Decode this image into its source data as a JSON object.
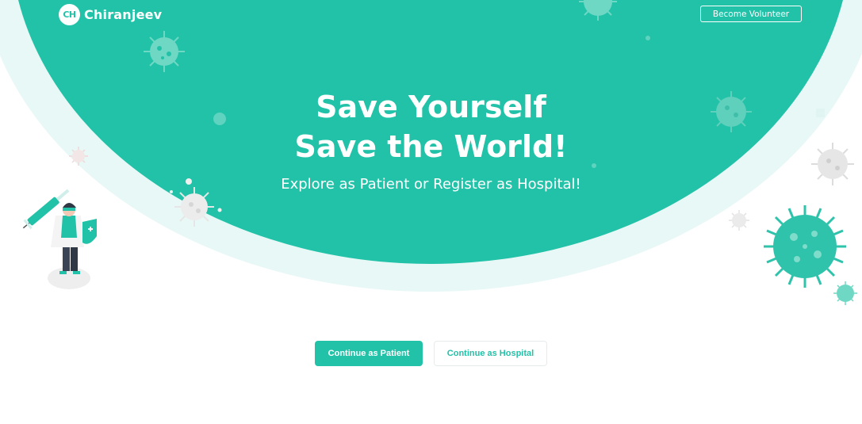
{
  "header": {
    "logo_badge": "CH",
    "brand_name": "Chiranjeev",
    "volunteer_label": "Become Volunteer"
  },
  "hero": {
    "headline_line1": "Save Yourself",
    "headline_line2": "Save the World!",
    "subline": "Explore as Patient or Register as Hospital!"
  },
  "actions": {
    "patient_label": "Continue as Patient",
    "hospital_label": "Continue as Hospital"
  },
  "colors": {
    "accent": "#22c2a8",
    "accent_light": "#e8f8f6",
    "background": "#ffffff"
  },
  "icons": [
    "virus-icon",
    "doctor-illustration",
    "syringe-icon",
    "shield-icon"
  ]
}
